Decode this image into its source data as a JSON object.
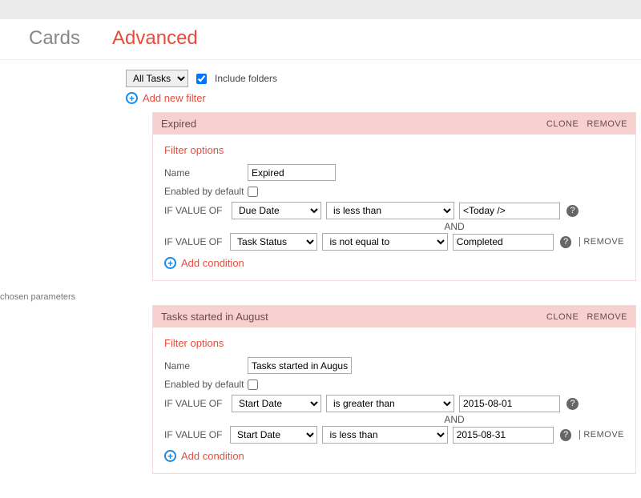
{
  "topbar": {},
  "tabs": {
    "cards": "Cards",
    "advanced": "Advanced"
  },
  "toolbar": {
    "datasource_options": [
      "All Tasks"
    ],
    "datasource_selected": "All Tasks",
    "include_folders_label": "Include folders",
    "include_folders_checked": true
  },
  "add_filter_label": "Add new filter",
  "side_text": "chosen parameters",
  "labels": {
    "filter_options": "Filter options",
    "name": "Name",
    "enabled_by_default": "Enabled by default",
    "if_value_of": "IF VALUE OF",
    "and": "AND",
    "add_condition": "Add condition",
    "clone": "CLONE",
    "remove_caps": "REMOVE",
    "remove": "REMOVE"
  },
  "filters": [
    {
      "title": "Expired",
      "name_value": "Expired",
      "enabled": false,
      "conditions": [
        {
          "field": "Due Date",
          "operator": "is less than",
          "value": "<Today />",
          "removable": false
        },
        {
          "field": "Task Status",
          "operator": "is not equal to",
          "value": "Completed",
          "removable": true
        }
      ]
    },
    {
      "title": "Tasks started in August",
      "name_value": "Tasks started in August",
      "enabled": false,
      "conditions": [
        {
          "field": "Start Date",
          "operator": "is greater than",
          "value": "2015-08-01",
          "removable": false
        },
        {
          "field": "Start Date",
          "operator": "is less than",
          "value": "2015-08-31",
          "removable": true
        }
      ]
    }
  ]
}
